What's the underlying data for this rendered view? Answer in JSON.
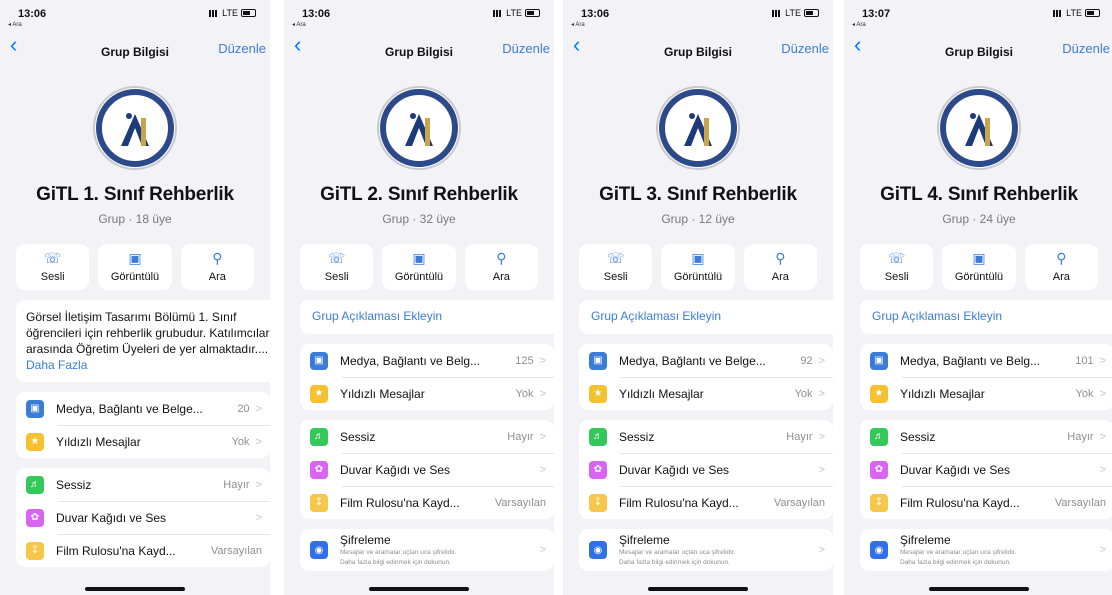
{
  "colors": {
    "accent": "#007aff",
    "media": "#3a7dd8",
    "starred": "#f5c12e",
    "mute": "#34c759",
    "wallpaper": "#d864f2",
    "save": "#f6c74a",
    "lock": "#2f6fe8"
  },
  "icons": {
    "back": "chevron-left-icon",
    "call": "phone-icon",
    "video": "video-icon",
    "search": "search-icon",
    "media": "photo-icon",
    "starred": "star-icon",
    "mute": "speaker-icon",
    "wallpaper": "flower-icon",
    "save": "download-icon",
    "lock": "lock-icon"
  },
  "phones": [
    {
      "status": {
        "time": "13:06",
        "back_app": "◂ Ara",
        "carrier": "LTE"
      },
      "nav": {
        "title": "Grup Bilgisi",
        "edit": "Düzenle"
      },
      "group": {
        "name": "GiTL 1. Sınıf Rehberlik",
        "sub": "Grup · 18 üye"
      },
      "actions": [
        {
          "label": "Sesli"
        },
        {
          "label": "Görüntülü"
        },
        {
          "label": "Ara"
        }
      ],
      "description": {
        "text": "Görsel İletişim Tasarımı Bölümü 1. Sınıf öğrencileri için rehberlik grubudur. Katılımcılar arasında Öğretim Üyeleri de yer almaktadır....",
        "more": "Daha Fazla"
      },
      "media": {
        "label": "Medya, Bağlantı ve Belge...",
        "value": "20"
      },
      "starred": {
        "label": "Yıldızlı Mesajlar",
        "value": "Yok"
      },
      "mute": {
        "label": "Sessiz",
        "value": "Hayır"
      },
      "wallpaper": {
        "label": "Duvar Kağıdı ve Ses"
      },
      "save": {
        "label": "Film Rulosu'na Kayd...",
        "value": "Varsayılan"
      }
    },
    {
      "status": {
        "time": "13:06",
        "back_app": "◂ Ara",
        "carrier": "LTE"
      },
      "nav": {
        "title": "Grup Bilgisi",
        "edit": "Düzenle"
      },
      "group": {
        "name": "GiTL 2. Sınıf Rehberlik",
        "sub": "Grup · 32 üye"
      },
      "actions": [
        {
          "label": "Sesli"
        },
        {
          "label": "Görüntülü"
        },
        {
          "label": "Ara"
        }
      ],
      "add_description": "Grup Açıklaması Ekleyin",
      "media": {
        "label": "Medya, Bağlantı ve Belg...",
        "value": "125"
      },
      "starred": {
        "label": "Yıldızlı Mesajlar",
        "value": "Yok"
      },
      "mute": {
        "label": "Sessiz",
        "value": "Hayır"
      },
      "wallpaper": {
        "label": "Duvar Kağıdı ve Ses"
      },
      "save": {
        "label": "Film Rulosu'na Kayd...",
        "value": "Varsayılan"
      },
      "encryption": {
        "title": "Şifreleme",
        "line1": "Mesajlar ve aramalar uçtan uca şifrelidir.",
        "line2": "Daha fazla bilgi edinmek için dokunun."
      }
    },
    {
      "status": {
        "time": "13:06",
        "back_app": "◂ Ara",
        "carrier": "LTE"
      },
      "nav": {
        "title": "Grup Bilgisi",
        "edit": "Düzenle"
      },
      "group": {
        "name": "GiTL 3. Sınıf Rehberlik",
        "sub": "Grup · 12 üye"
      },
      "actions": [
        {
          "label": "Sesli"
        },
        {
          "label": "Görüntülü"
        },
        {
          "label": "Ara"
        }
      ],
      "add_description": "Grup Açıklaması Ekleyin",
      "media": {
        "label": "Medya, Bağlantı ve Belge...",
        "value": "92"
      },
      "starred": {
        "label": "Yıldızlı Mesajlar",
        "value": "Yok"
      },
      "mute": {
        "label": "Sessiz",
        "value": "Hayır"
      },
      "wallpaper": {
        "label": "Duvar Kağıdı ve Ses"
      },
      "save": {
        "label": "Film Rulosu'na Kayd...",
        "value": "Varsayılan"
      },
      "encryption": {
        "title": "Şifreleme",
        "line1": "Mesajlar ve aramalar uçtan uca şifrelidir.",
        "line2": "Daha fazla bilgi edinmek için dokunun."
      }
    },
    {
      "status": {
        "time": "13:07",
        "back_app": "◂ Ara",
        "carrier": "LTE"
      },
      "nav": {
        "title": "Grup Bilgisi",
        "edit": "Düzenle"
      },
      "group": {
        "name": "GiTL 4. Sınıf Rehberlik",
        "sub": "Grup · 24 üye"
      },
      "actions": [
        {
          "label": "Sesli"
        },
        {
          "label": "Görüntülü"
        },
        {
          "label": "Ara"
        }
      ],
      "add_description": "Grup Açıklaması Ekleyin",
      "media": {
        "label": "Medya, Bağlantı ve Belg...",
        "value": "101"
      },
      "starred": {
        "label": "Yıldızlı Mesajlar",
        "value": "Yok"
      },
      "mute": {
        "label": "Sessiz",
        "value": "Hayır"
      },
      "wallpaper": {
        "label": "Duvar Kağıdı ve Ses"
      },
      "save": {
        "label": "Film Rulosu'na Kayd...",
        "value": "Varsayılan"
      },
      "encryption": {
        "title": "Şifreleme",
        "line1": "Mesajlar ve aramalar uçtan uca şifrelidir.",
        "line2": "Daha fazla bilgi edinmek için dokunun."
      }
    }
  ]
}
